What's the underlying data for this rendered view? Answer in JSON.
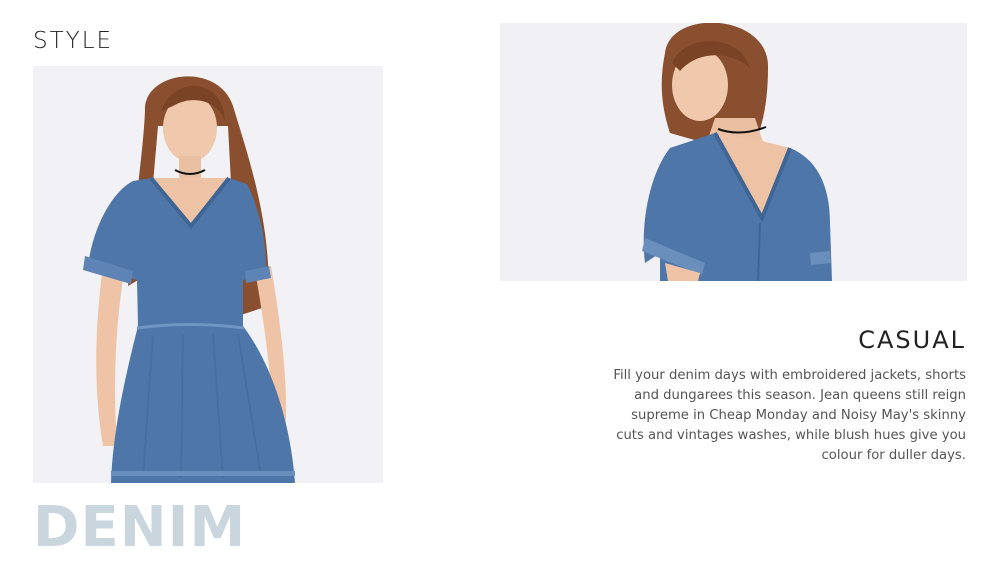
{
  "headings": {
    "style": "STYLE",
    "casual": "CASUAL",
    "denim": "DENIM"
  },
  "description": "Fill your denim days with embroidered jackets, shorts and dungarees this season. Jean queens still reign supreme in Cheap Monday and Noisy May's skinny cuts and vintages washes, while blush hues give you colour for duller days.",
  "colors": {
    "background": "#ffffff",
    "heading_text": "#222222",
    "body_text": "#555555",
    "denim_word": "#c9d6dd",
    "denim_fabric": "#4f76a8",
    "photo_backdrop": "#f1f0f4"
  },
  "images": {
    "front": "model-in-denim-dress-front-photo",
    "back": "model-in-denim-dress-back-photo"
  }
}
